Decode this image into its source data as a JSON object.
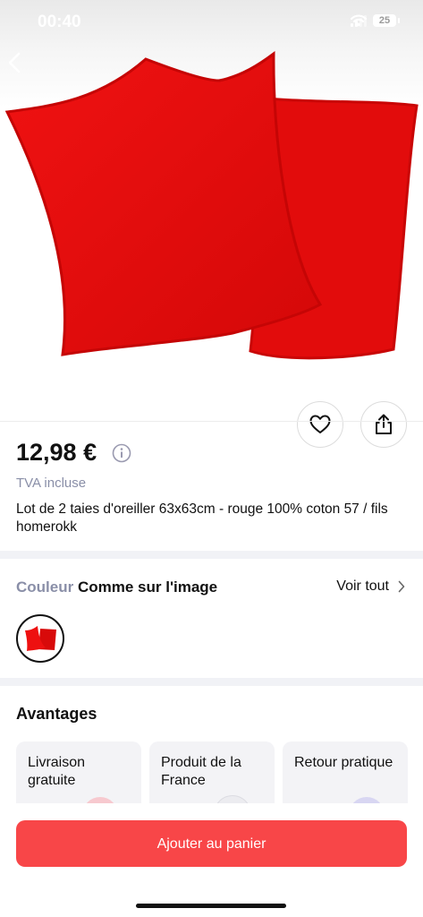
{
  "status_bar": {
    "time": "00:40",
    "battery": "25"
  },
  "product": {
    "price": "12,98 €",
    "tax_note": "TVA incluse",
    "title": "Lot de 2 taies d'oreiller 63x63cm - rouge 100% coton 57 / fils homerokk",
    "image_color": "#e60a0a"
  },
  "color_section": {
    "label": "Couleur",
    "value": "Comme sur l'image",
    "see_all": "Voir tout"
  },
  "advantages": {
    "title": "Avantages",
    "cards": [
      {
        "label": "Livraison gratuite"
      },
      {
        "label": "Produit de la France"
      },
      {
        "label": "Retour pratique"
      }
    ]
  },
  "cta": {
    "add_to_cart": "Ajouter au panier",
    "color": "#f84648"
  }
}
